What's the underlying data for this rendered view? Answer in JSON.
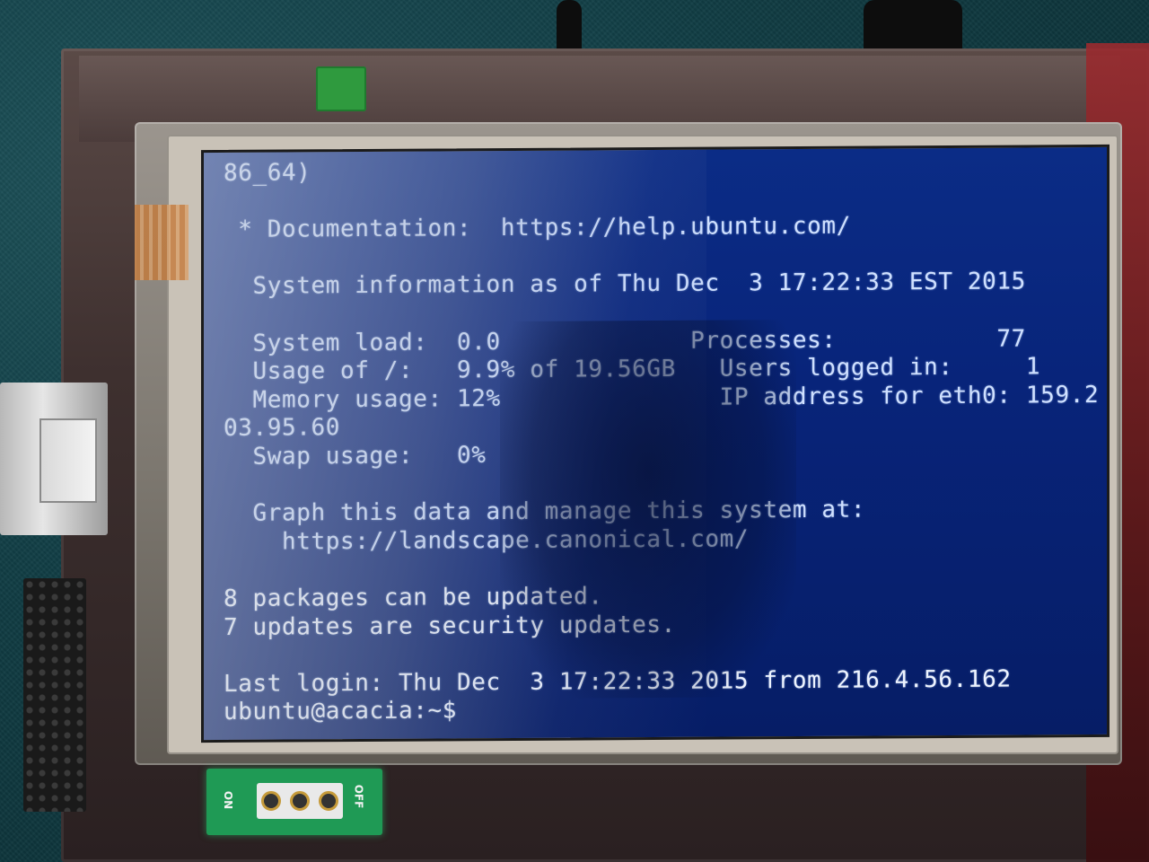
{
  "terminal": {
    "lines": [
      "86_64)",
      "",
      " * Documentation:  https://help.ubuntu.com/",
      "",
      "  System information as of Thu Dec  3 17:22:33 EST 2015",
      "",
      "  System load:  0.0             Processes:           77",
      "  Usage of /:   9.9% of 19.56GB   Users logged in:     1",
      "  Memory usage: 12%               IP address for eth0: 159.2",
      "03.95.60",
      "  Swap usage:   0%",
      "",
      "  Graph this data and manage this system at:",
      "    https://landscape.canonical.com/",
      "",
      "8 packages can be updated.",
      "7 updates are security updates.",
      "",
      "Last login: Thu Dec  3 17:22:33 2015 from 216.4.56.162",
      "ubuntu@acacia:~$"
    ]
  },
  "switch": {
    "on_label": "ON",
    "off_label": "OFF"
  }
}
